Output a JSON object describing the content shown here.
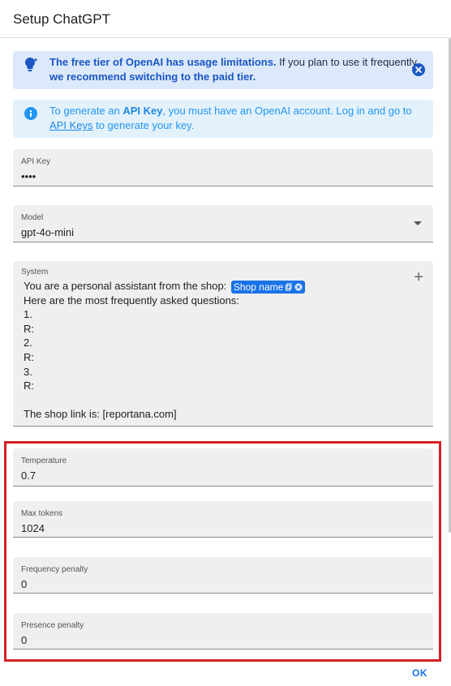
{
  "dialog": {
    "title": "Setup ChatGPT"
  },
  "alerts": {
    "warning": {
      "icon": "lightbulb-icon",
      "bold1": "The free tier of OpenAI has usage limitations.",
      "text1": " If you plan to use it frequently, ",
      "bold2": "we recommend switching to the paid tier."
    },
    "info": {
      "icon": "info-icon",
      "text1": "To generate an ",
      "bold1": "API Key",
      "text2": ", you must have an OpenAI account. Log in and go to ",
      "link": "API Keys",
      "text3": " to generate your key."
    }
  },
  "fields": {
    "api_key": {
      "label": "API Key",
      "value": "••••"
    },
    "model": {
      "label": "Model",
      "value": "gpt-4o-mini"
    },
    "system": {
      "label": "System",
      "line1_prefix": "You are a personal assistant from the shop: ",
      "chip": "Shop name",
      "lines": [
        "Here are the most frequently asked questions:",
        "1.",
        "R:",
        "2.",
        "R:",
        "3.",
        "R:",
        "",
        "The shop link is: [reportana.com]"
      ]
    },
    "temperature": {
      "label": "Temperature",
      "value": "0.7"
    },
    "max_tokens": {
      "label": "Max tokens",
      "value": "1024"
    },
    "frequency_penalty": {
      "label": "Frequency penalty",
      "value": "0"
    },
    "presence_penalty": {
      "label": "Presence penalty",
      "value": "0"
    }
  },
  "actions": {
    "ok": "OK"
  },
  "colors": {
    "accent": "#1a73e8",
    "highlight": "#d61f26",
    "warning_bg": "#dce9fb",
    "info_bg": "#e3f1fb"
  }
}
